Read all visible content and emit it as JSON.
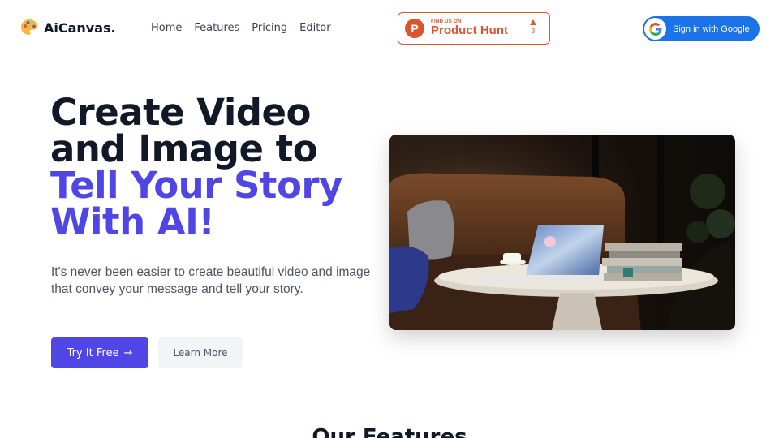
{
  "header": {
    "brand": "AiCanvas.",
    "nav": [
      "Home",
      "Features",
      "Pricing",
      "Editor"
    ],
    "product_hunt": {
      "small": "FIND US ON",
      "big": "Product Hunt",
      "logo_letter": "P",
      "votes": "3"
    },
    "google_signin_label": "Sign in with Google"
  },
  "hero": {
    "title_line1": "Create Video",
    "title_line2": "and Image to",
    "title_line3": "Tell Your Story",
    "title_line4": "With AI!",
    "description": "It's never been easier to create beautiful video and image that convey your message and tell your story.",
    "primary_cta": "Try It Free",
    "primary_cta_arrow": "→",
    "secondary_cta": "Learn More"
  },
  "features": {
    "title": "Our Features"
  },
  "colors": {
    "accent": "#4f46e5",
    "text_dark": "#111827",
    "product_hunt": "#da552f",
    "google_blue": "#1a73e8"
  },
  "icons": {
    "logo": "palette-icon",
    "product_hunt": "product-hunt-icon",
    "google": "google-icon",
    "arrow": "arrow-right-icon"
  }
}
